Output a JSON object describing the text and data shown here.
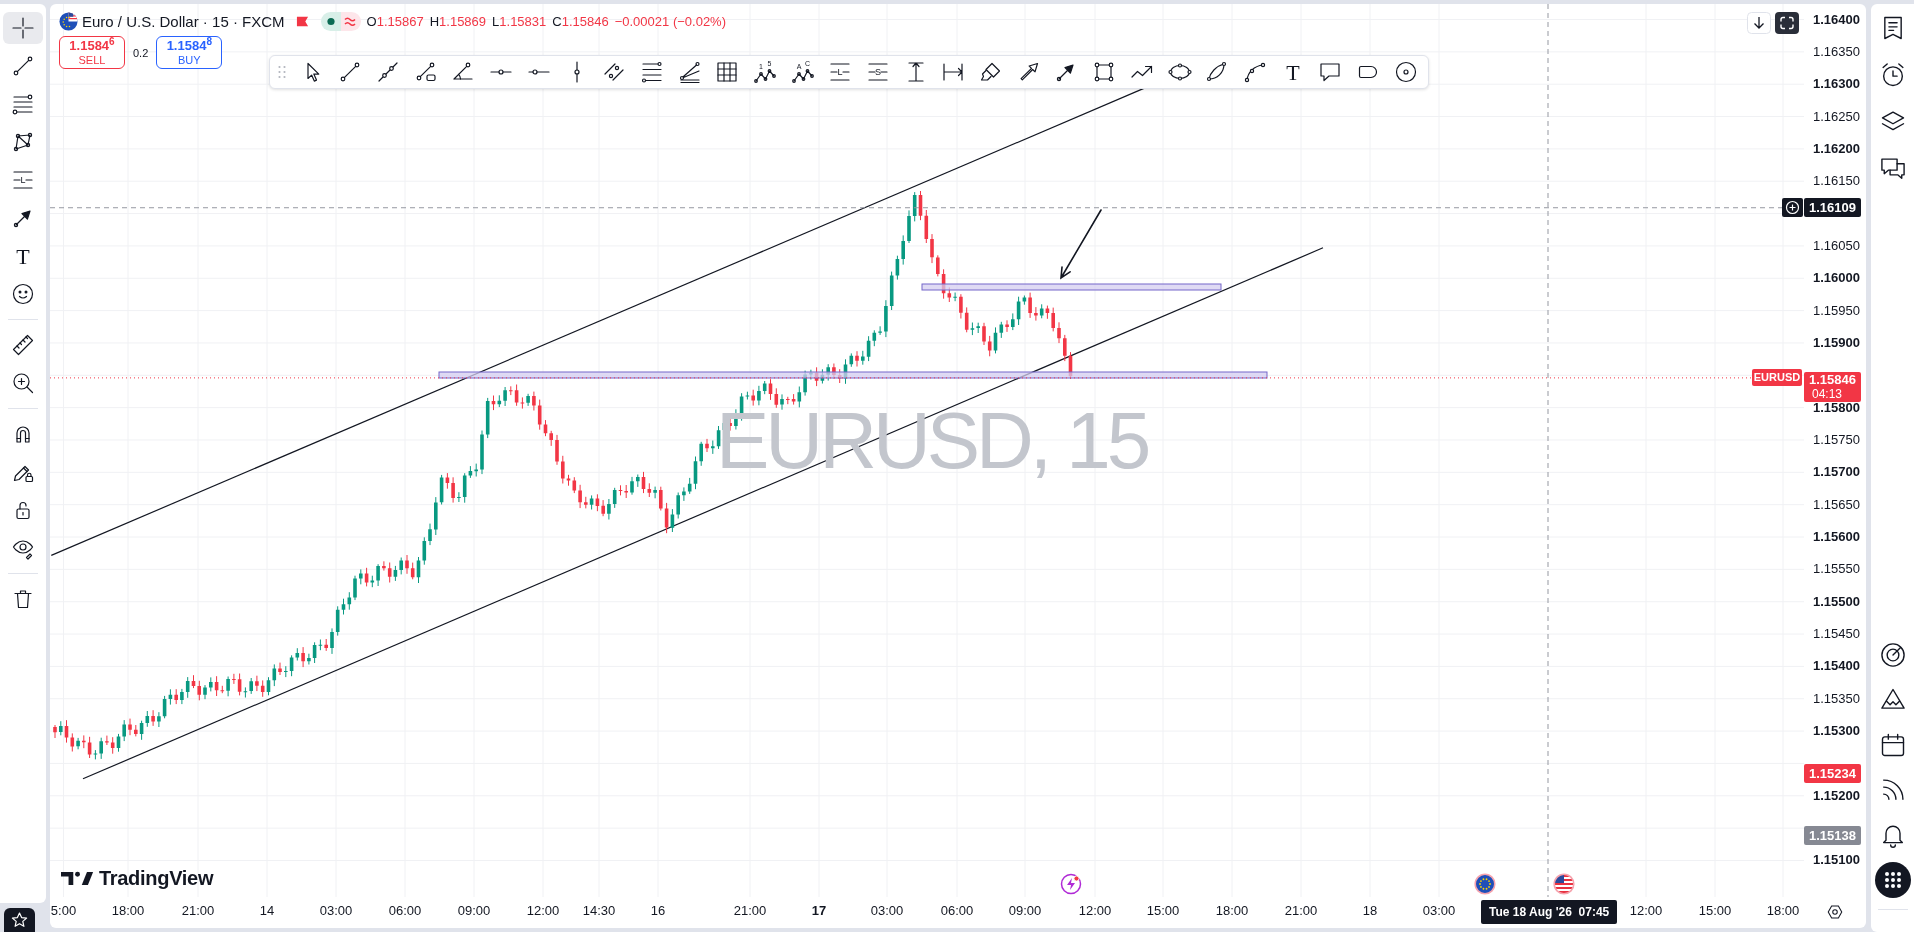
{
  "left_toolbar": {
    "groups": [
      {
        "tools": [
          {
            "kind": "crosshair",
            "selected": true
          },
          {
            "kind": "line",
            "selected": false
          },
          {
            "kind": "stacked-lines",
            "selected": false
          },
          {
            "kind": "pattern",
            "selected": false
          },
          {
            "kind": "position",
            "label": "L",
            "selected": false
          },
          {
            "kind": "arrow-marker",
            "selected": false
          },
          {
            "kind": "text",
            "label": "T",
            "selected": false
          },
          {
            "kind": "smiley",
            "selected": false
          }
        ]
      },
      {
        "tools": [
          {
            "kind": "ruler",
            "selected": false
          },
          {
            "kind": "zoom-in",
            "selected": false
          }
        ]
      },
      {
        "tools": [
          {
            "kind": "magnet",
            "selected": false
          },
          {
            "kind": "pencil-lock",
            "selected": false
          },
          {
            "kind": "lock-open",
            "selected": false
          },
          {
            "kind": "eye",
            "selected": false
          }
        ]
      },
      {
        "tools": [
          {
            "kind": "trash",
            "selected": false
          }
        ]
      }
    ]
  },
  "legend": {
    "title": "Euro / U.S. Dollar · 15 · FXCM",
    "ohlc": [
      {
        "label": "O",
        "value": "1.15867"
      },
      {
        "label": "H",
        "value": "1.15869"
      },
      {
        "label": "L",
        "value": "1.15831"
      },
      {
        "label": "C",
        "value": "1.15846"
      }
    ],
    "change": "−0.00021 (−0.02%)"
  },
  "trade": {
    "sell": {
      "price": "1.1584$^{6}$",
      "label": "SELL"
    },
    "spread": "0.2",
    "buy": {
      "price": "1.1584$^{8}$",
      "label": "BUY"
    }
  },
  "drawing_toolbar": {
    "tools": [
      {
        "kind": "grip"
      },
      {
        "kind": "cursor"
      },
      {
        "kind": "line"
      },
      {
        "kind": "ray"
      },
      {
        "kind": "line-box"
      },
      {
        "kind": "angle"
      },
      {
        "kind": "hline-ray"
      },
      {
        "kind": "hline"
      },
      {
        "kind": "vline"
      },
      {
        "kind": "parallel"
      },
      {
        "kind": "fib-lines"
      },
      {
        "kind": "fan"
      },
      {
        "kind": "grid"
      },
      {
        "kind": "wave",
        "labels": [
          "1",
          "5"
        ]
      },
      {
        "kind": "wave",
        "labels": [
          "A",
          "C"
        ]
      },
      {
        "kind": "position",
        "labels": [
          "L"
        ]
      },
      {
        "kind": "position",
        "labels": [
          "S"
        ]
      },
      {
        "kind": "price-range"
      },
      {
        "kind": "date-range"
      },
      {
        "kind": "brush"
      },
      {
        "kind": "arrow"
      },
      {
        "kind": "arrow-marker"
      },
      {
        "kind": "rectangle"
      },
      {
        "kind": "path"
      },
      {
        "kind": "ellipse"
      },
      {
        "kind": "arc"
      },
      {
        "kind": "curve"
      },
      {
        "kind": "text",
        "labels": [
          "T"
        ]
      },
      {
        "kind": "callout"
      },
      {
        "kind": "rounded-rect"
      },
      {
        "kind": "circle"
      }
    ]
  },
  "symbol_watermark": "EURUSD, 15",
  "logo_text": "TradingView",
  "price_axis": {
    "labels": [
      {
        "text": "1.16400",
        "major": true
      },
      {
        "text": "1.16350",
        "major": false
      },
      {
        "text": "1.16300",
        "major": true
      },
      {
        "text": "1.16250",
        "major": false
      },
      {
        "text": "1.16200",
        "major": true
      },
      {
        "text": "1.16150",
        "major": false
      },
      {
        "text": "1.16050",
        "major": false
      },
      {
        "text": "1.16000",
        "major": true
      },
      {
        "text": "1.15950",
        "major": false
      },
      {
        "text": "1.15900",
        "major": true
      },
      {
        "text": "1.15800",
        "major": true
      },
      {
        "text": "1.15750",
        "major": false
      },
      {
        "text": "1.15700",
        "major": true
      },
      {
        "text": "1.15650",
        "major": false
      },
      {
        "text": "1.15600",
        "major": true
      },
      {
        "text": "1.15550",
        "major": false
      },
      {
        "text": "1.15500",
        "major": true
      },
      {
        "text": "1.15450",
        "major": false
      },
      {
        "text": "1.15400",
        "major": true
      },
      {
        "text": "1.15350",
        "major": false
      },
      {
        "text": "1.15300",
        "major": true
      },
      {
        "text": "1.15200",
        "major": true
      },
      {
        "text": "1.15100",
        "major": true
      }
    ],
    "markers": [
      {
        "kind": "crosshair",
        "text": "1.16109",
        "color": "#131722"
      },
      {
        "kind": "last",
        "text": "1.15846",
        "countdown": "04:13",
        "symbol": "EURUSD",
        "color": "#f23645"
      },
      {
        "kind": "level",
        "text": "1.15234",
        "color": "#f23645"
      },
      {
        "kind": "level",
        "text": "1.15138",
        "color": "#868993"
      }
    ]
  },
  "time_axis": {
    "labels": [
      {
        "text": "5:00",
        "major": false
      },
      {
        "text": "18:00",
        "major": false
      },
      {
        "text": "21:00",
        "major": false
      },
      {
        "text": "14",
        "major": false
      },
      {
        "text": "03:00",
        "major": false
      },
      {
        "text": "06:00",
        "major": false
      },
      {
        "text": "09:00",
        "major": false
      },
      {
        "text": "12:00",
        "major": false
      },
      {
        "text": "14:30",
        "major": false
      },
      {
        "text": "16",
        "major": false
      },
      {
        "text": "21:00",
        "major": false
      },
      {
        "text": "17",
        "major": true
      },
      {
        "text": "03:00",
        "major": false
      },
      {
        "text": "06:00",
        "major": false
      },
      {
        "text": "09:00",
        "major": false
      },
      {
        "text": "12:00",
        "major": false
      },
      {
        "text": "15:00",
        "major": false
      },
      {
        "text": "18:00",
        "major": false
      },
      {
        "text": "21:00",
        "major": false
      },
      {
        "text": "18",
        "major": false
      },
      {
        "text": "03:00",
        "major": false
      },
      {
        "text": "12:00",
        "major": false
      },
      {
        "text": "15:00",
        "major": false
      },
      {
        "text": "18:00",
        "major": false
      }
    ],
    "crosshair_label": "Tue 18 Aug '26  07:45"
  },
  "right_sidebar": {
    "top_tools": [
      {
        "kind": "watchlist"
      },
      {
        "kind": "alarm"
      },
      {
        "kind": "layers"
      },
      {
        "kind": "chat"
      }
    ],
    "bottom_tools": [
      {
        "kind": "target"
      },
      {
        "kind": "mountains"
      },
      {
        "kind": "calendar"
      },
      {
        "kind": "feed"
      },
      {
        "kind": "bell"
      },
      {
        "kind": "apps"
      }
    ]
  }
}
